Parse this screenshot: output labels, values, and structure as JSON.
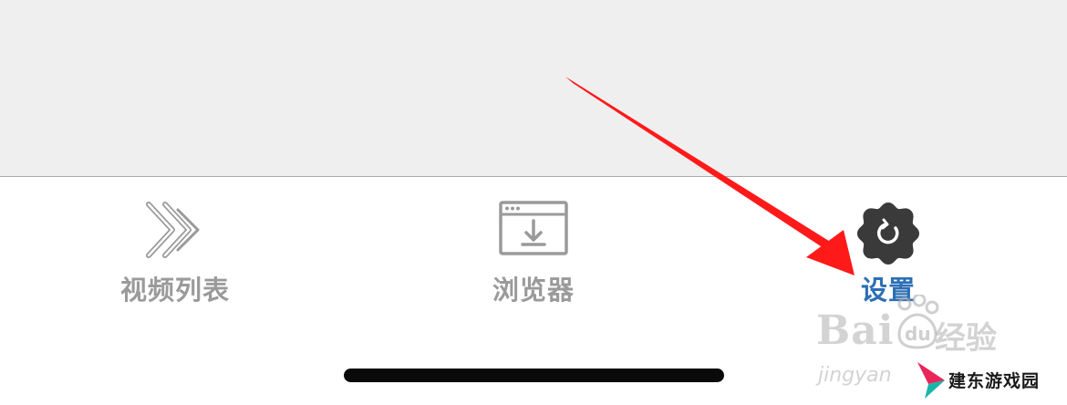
{
  "tabs": [
    {
      "id": "video-list",
      "label": "视频列表",
      "icon": "double-chevron-right-icon",
      "active": false
    },
    {
      "id": "browser",
      "label": "浏览器",
      "icon": "browser-download-icon",
      "active": false
    },
    {
      "id": "settings",
      "label": "设置",
      "icon": "gear-icon",
      "active": true
    }
  ],
  "watermarks": {
    "baidu_brand": "Bai",
    "baidu_du": "du",
    "baidu_cn": "经验",
    "baidu_pinyin": "jingyan",
    "site_name": "建东游戏园"
  },
  "colors": {
    "background_top": "#f0eff0",
    "tab_inactive": "#9a9a9a",
    "tab_active": "#2d6fb5",
    "gear_fill": "#3a3a3a",
    "arrow": "#ff1a1a"
  }
}
